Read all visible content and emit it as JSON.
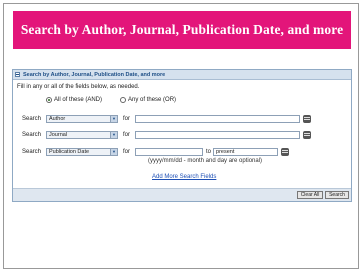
{
  "slide_title": "Search by Author, Journal, Publication Date, and more",
  "panel": {
    "header": "Search by Author, Journal, Publication Date, and more",
    "instruction": "Fill in any or all of the fields below, as needed.",
    "match_options": [
      {
        "label": "All of these (AND)",
        "selected": true
      },
      {
        "label": "Any of these (OR)",
        "selected": false
      }
    ],
    "rows": [
      {
        "label": "Search",
        "field": "Author",
        "for": "for",
        "value": ""
      },
      {
        "label": "Search",
        "field": "Journal",
        "for": "for",
        "value": ""
      },
      {
        "label": "Search",
        "field": "Publication Date",
        "for": "for",
        "from": "",
        "to_label": "to",
        "to_value": "present"
      }
    ],
    "date_hint": "(yyyy/mm/dd - month and day are optional)",
    "add_more_link": "Add More Search Fields",
    "buttons": {
      "clear": "Clear All",
      "search": "Search"
    }
  },
  "colors": {
    "title_bar": "#e3157a",
    "panel_header": "#d5e1ee",
    "link": "#1d4fb5"
  }
}
